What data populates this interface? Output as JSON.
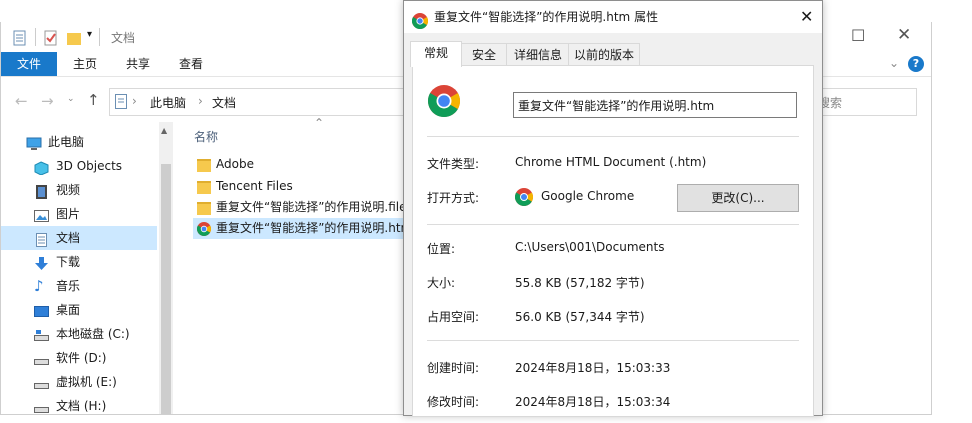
{
  "explorer": {
    "title": "文档",
    "ribbon_tabs": [
      "文件",
      "主页",
      "共享",
      "查看"
    ],
    "breadcrumb": [
      "此电脑",
      "文档"
    ],
    "search_placeholder": "搜索",
    "column_header": "名称",
    "nav_items": [
      {
        "label": "此电脑",
        "icon": "computer-icon"
      },
      {
        "label": "3D Objects",
        "icon": "cube-icon"
      },
      {
        "label": "视频",
        "icon": "video-icon"
      },
      {
        "label": "图片",
        "icon": "picture-icon"
      },
      {
        "label": "文档",
        "icon": "document-icon"
      },
      {
        "label": "下载",
        "icon": "download-icon"
      },
      {
        "label": "音乐",
        "icon": "music-icon"
      },
      {
        "label": "桌面",
        "icon": "desktop-icon"
      },
      {
        "label": "本地磁盘 (C:)",
        "icon": "drive-icon"
      },
      {
        "label": "软件 (D:)",
        "icon": "drive-icon"
      },
      {
        "label": "虚拟机 (E:)",
        "icon": "drive-icon"
      },
      {
        "label": "文档 (H:)",
        "icon": "drive-icon"
      }
    ],
    "files": [
      {
        "name": "Adobe",
        "type": "folder"
      },
      {
        "name": "Tencent Files",
        "type": "folder"
      },
      {
        "name": "重复文件“智能选择”的作用说明.files",
        "type": "folder"
      },
      {
        "name": "重复文件“智能选择”的作用说明.htm",
        "type": "chrome"
      }
    ]
  },
  "dialog": {
    "title": "重复文件“智能选择”的作用说明.htm 属性",
    "tabs": [
      "常规",
      "安全",
      "详细信息",
      "以前的版本"
    ],
    "file_name": "重复文件“智能选择”的作用说明.htm",
    "labels": {
      "type": "文件类型:",
      "opens_with": "打开方式:",
      "location": "位置:",
      "size": "大小:",
      "size_on_disk": "占用空间:",
      "created": "创建时间:",
      "modified": "修改时间:"
    },
    "values": {
      "type": "Chrome HTML Document (.htm)",
      "opens_with": "Google Chrome",
      "location": "C:\\Users\\001\\Documents",
      "size": "55.8 KB (57,182 字节)",
      "size_on_disk": "56.0 KB (57,344 字节)",
      "created": "2024年8月18日，15:03:33",
      "modified": "2024年8月18日，15:03:34"
    },
    "change_button": "更改(C)..."
  },
  "colors": {
    "accent": "#1979ca",
    "selection": "#cce8ff",
    "folder": "#f6c94d"
  }
}
